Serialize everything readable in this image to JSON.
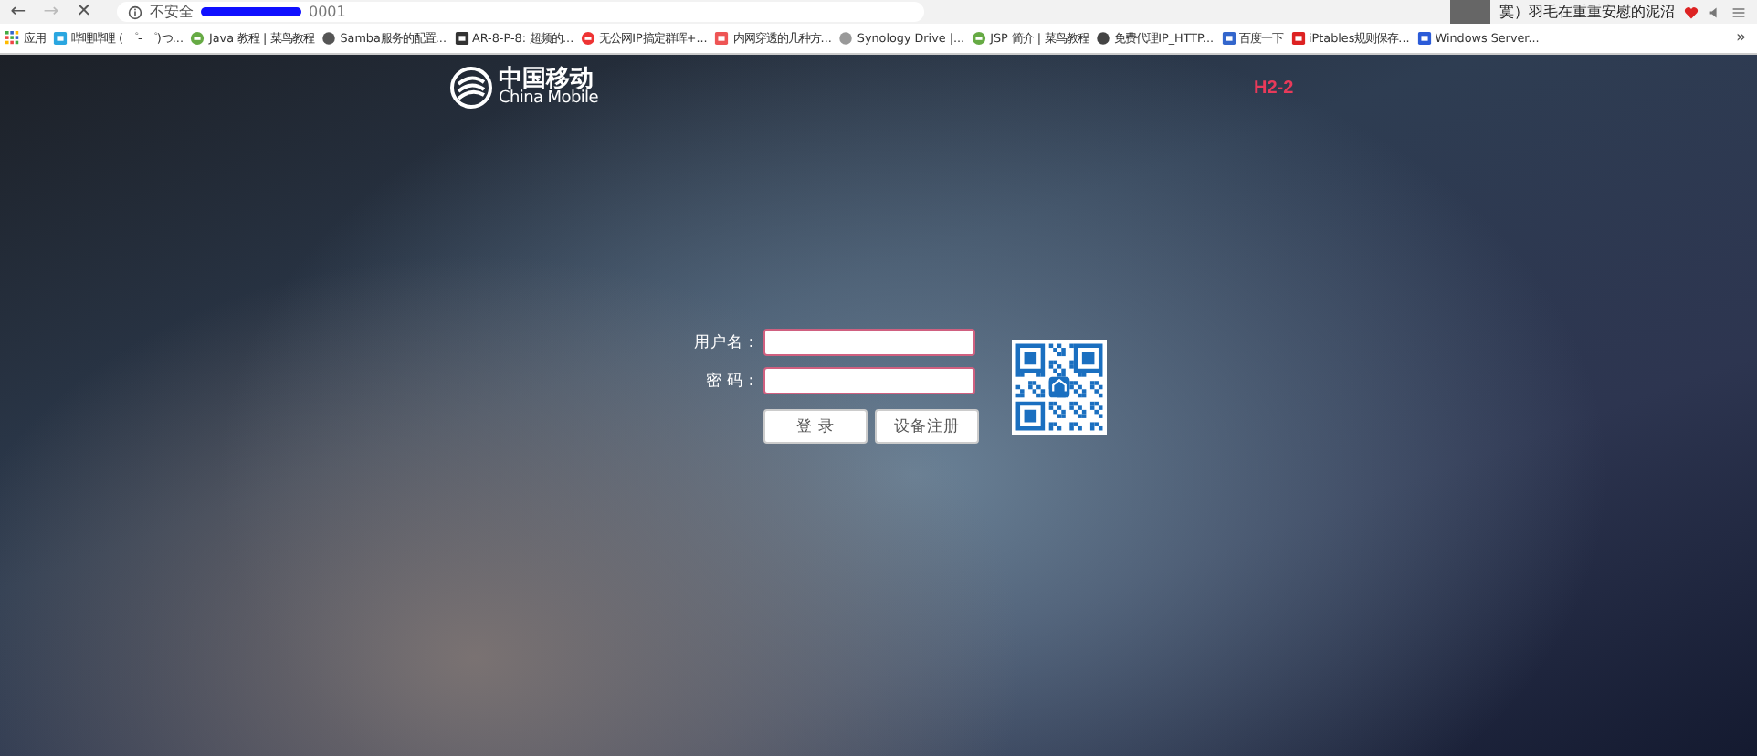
{
  "browser": {
    "nav": [
      "←",
      "→",
      "✕"
    ],
    "security": "不安全",
    "address": "0001",
    "media_title": "寞）羽毛在重重安慰的泥沼",
    "bookmarks": [
      {
        "label": "应用",
        "kind": "apps"
      },
      {
        "label": "哔哩哔哩 ( ゜- ゜)つ...",
        "kind": "tv"
      },
      {
        "label": "Java 教程 | 菜鸟教程",
        "kind": "runoob"
      },
      {
        "label": "Samba服务的配置...",
        "kind": "samba"
      },
      {
        "label": "AR-8-P-8: 超频的...",
        "kind": "doc"
      },
      {
        "label": "无公网IP搞定群晖+...",
        "kind": "red"
      },
      {
        "label": "内网穿透的几种方...",
        "kind": "redsq"
      },
      {
        "label": "Synology Drive |...",
        "kind": "syn"
      },
      {
        "label": "JSP 简介 | 菜鸟教程",
        "kind": "runoob"
      },
      {
        "label": "免费代理IP_HTTP...",
        "kind": "globe"
      },
      {
        "label": "百度一下",
        "kind": "baidu"
      },
      {
        "label": "iPtables规则保存...",
        "kind": "c"
      },
      {
        "label": "Windows Server...",
        "kind": "win"
      }
    ],
    "more": "»"
  },
  "page": {
    "logo_cn": "中国移动",
    "logo_en": "China Mobile",
    "device": "H2-2",
    "form": {
      "username_label": "用户名：",
      "password_label": "密 码：",
      "login": "登 录",
      "register": "设备注册"
    }
  }
}
